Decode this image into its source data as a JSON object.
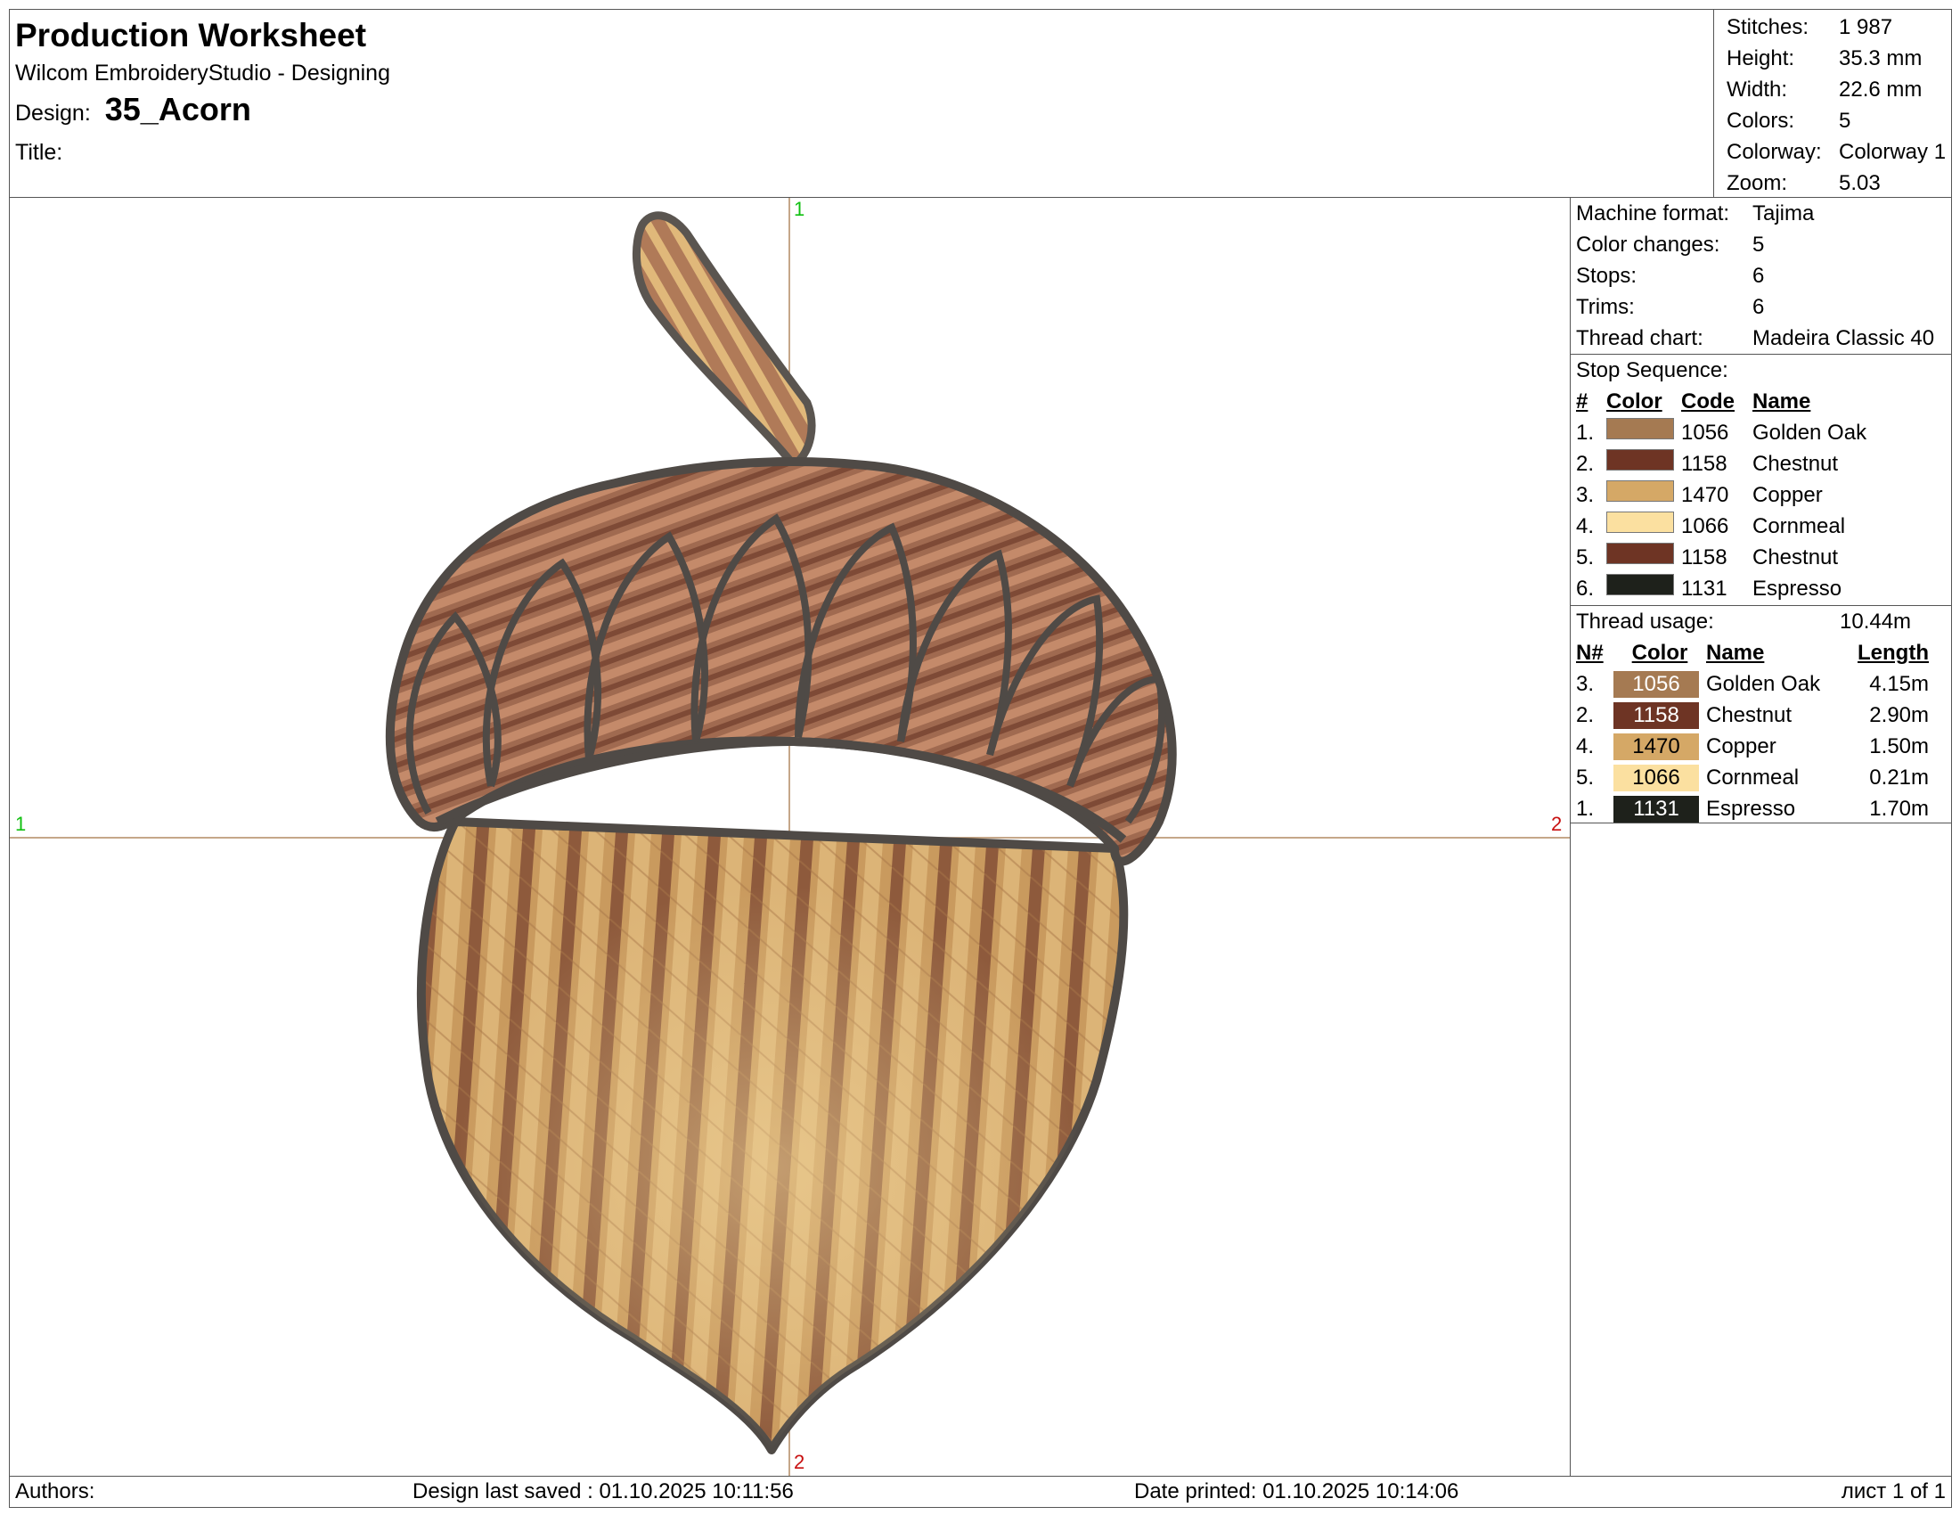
{
  "header": {
    "title": "Production Worksheet",
    "app": "Wilcom EmbroideryStudio - Designing",
    "design_label": "Design:",
    "design_name": "35_Acorn",
    "title_label": "Title:",
    "title_value": ""
  },
  "stats": [
    {
      "label": "Stitches:",
      "value": "1 987"
    },
    {
      "label": "Height:",
      "value": "35.3 mm"
    },
    {
      "label": "Width:",
      "value": "22.6 mm"
    },
    {
      "label": "Colors:",
      "value": "5"
    },
    {
      "label": "Colorway:",
      "value": "Colorway 1"
    },
    {
      "label": "Zoom:",
      "value": "5.03"
    }
  ],
  "machine": [
    {
      "label": "Machine format:",
      "value": "Tajima"
    },
    {
      "label": "Color changes:",
      "value": "5"
    },
    {
      "label": "Stops:",
      "value": "6"
    },
    {
      "label": "Trims:",
      "value": "6"
    },
    {
      "label": "Thread chart:",
      "value": "Madeira Classic 40"
    }
  ],
  "stop_sequence": {
    "title": "Stop Sequence:",
    "headers": {
      "num": "#",
      "color": "Color",
      "code": "Code",
      "name": "Name"
    },
    "rows": [
      {
        "num": "1.",
        "color": "#a57a52",
        "code": "1056",
        "name": "Golden Oak"
      },
      {
        "num": "2.",
        "color": "#6e3424",
        "code": "1158",
        "name": "Chestnut"
      },
      {
        "num": "3.",
        "color": "#d5a866",
        "code": "1470",
        "name": "Copper"
      },
      {
        "num": "4.",
        "color": "#fbe0a0",
        "code": "1066",
        "name": "Cornmeal"
      },
      {
        "num": "5.",
        "color": "#6e3424",
        "code": "1158",
        "name": "Chestnut"
      },
      {
        "num": "6.",
        "color": "#1e211b",
        "code": "1131",
        "name": "Espresso"
      }
    ]
  },
  "thread_usage": {
    "title": "Thread usage:",
    "total": "10.44m",
    "headers": {
      "num": "N#",
      "color": "Color",
      "name": "Name",
      "length": "Length"
    },
    "rows": [
      {
        "num": "3.",
        "code": "1056",
        "color": "#a57a52",
        "text_color": "#ffffff",
        "name": "Golden Oak",
        "length": "4.15m"
      },
      {
        "num": "2.",
        "code": "1158",
        "color": "#6e3424",
        "text_color": "#ffffff",
        "name": "Chestnut",
        "length": "2.90m"
      },
      {
        "num": "4.",
        "code": "1470",
        "color": "#d5a866",
        "text_color": "#000000",
        "name": "Copper",
        "length": "1.50m"
      },
      {
        "num": "5.",
        "code": "1066",
        "color": "#fbe0a0",
        "text_color": "#000000",
        "name": "Cornmeal",
        "length": "0.21m"
      },
      {
        "num": "1.",
        "code": "1131",
        "color": "#1e211b",
        "text_color": "#ffffff",
        "name": "Espresso",
        "length": "1.70m"
      }
    ]
  },
  "canvas": {
    "markers": {
      "v_top": "1",
      "v_bottom": "2",
      "h_left": "1",
      "h_right": "2"
    }
  },
  "footer": {
    "authors": "Authors:",
    "last_saved": "Design last saved : 01.10.2025 10:11:56",
    "printed": "Date printed: 01.10.2025 10:14:06",
    "page": "лист 1 of 1"
  }
}
